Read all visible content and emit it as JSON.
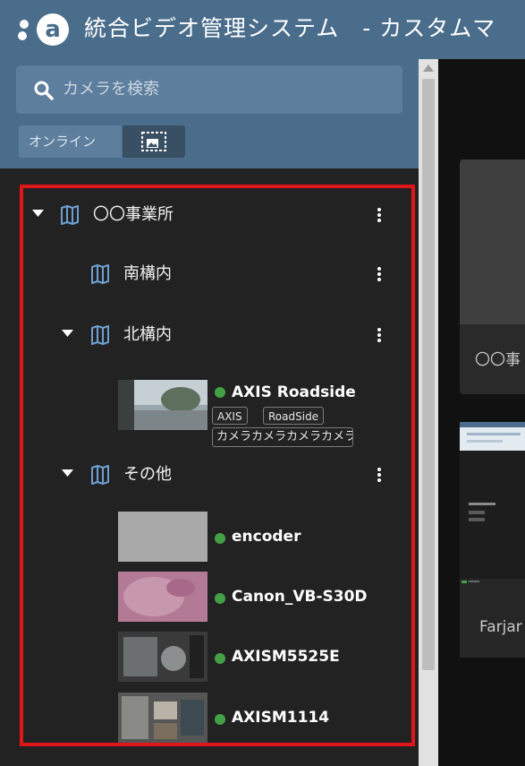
{
  "app": {
    "logo_text": "a",
    "title": "統合ビデオ管理システム　- カスタムマ"
  },
  "sidebar": {
    "search": {
      "placeholder": "カメラを検索",
      "icon": "search-icon"
    },
    "filters": {
      "online_label": "オンライン",
      "thumbnail_toggle_icon": "image-thumbnail-icon"
    }
  },
  "tree": [
    {
      "label": "〇〇事業所",
      "icon": "map-icon",
      "expanded": true,
      "level": 0
    },
    {
      "label": "南構内",
      "icon": "map-icon",
      "expanded": false,
      "level": 1
    },
    {
      "label": "北構内",
      "icon": "map-icon",
      "expanded": true,
      "level": 1
    },
    {
      "label": "その他",
      "icon": "map-icon",
      "expanded": true,
      "level": 1
    }
  ],
  "cameras": [
    {
      "name": "AXIS Roadside N",
      "status": "online",
      "tags": [
        "AXIS",
        "RoadSide"
      ],
      "description": "カメラカメラカメラカメラ"
    },
    {
      "name": "encoder",
      "status": "online"
    },
    {
      "name": "Canon_VB-S30D",
      "status": "online"
    },
    {
      "name": "AXISM5525E",
      "status": "online"
    },
    {
      "name": "AXISM1114",
      "status": "online"
    }
  ],
  "main": {
    "cards": [
      {
        "label": "〇〇事"
      },
      {
        "label": "Farjar"
      }
    ]
  },
  "colors": {
    "header": "#4a6d8c",
    "panel": "#222222",
    "highlight": "#e0161b",
    "online": "#43a047"
  }
}
